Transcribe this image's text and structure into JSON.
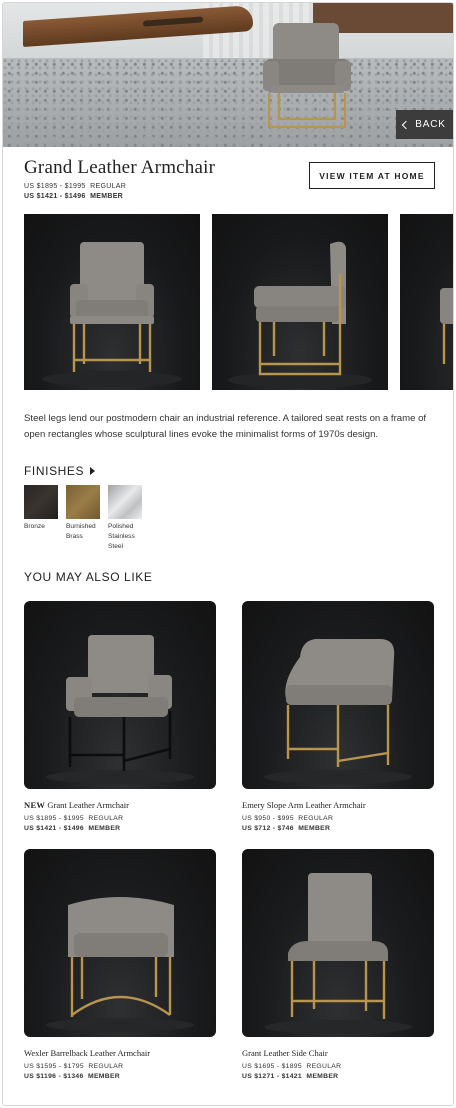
{
  "hero": {
    "back_label": "BACK"
  },
  "product": {
    "title": "Grand Leather Armchair",
    "regular_price": "US $1895 - $1995",
    "regular_label": "REGULAR",
    "member_price": "US $1421 - $1496",
    "member_label": "MEMBER",
    "view_at_home": "VIEW ITEM AT HOME",
    "description": "Steel legs lend our postmodern chair an industrial reference. A tailored seat rests on a frame of open rectangles whose sculptural lines evoke the minimalist forms of 1970s design."
  },
  "finishes": {
    "heading": "FINISHES",
    "items": [
      {
        "label": "Bronze",
        "color": "#2f2a26"
      },
      {
        "label": "Burnished Brass",
        "color": "#8a7040"
      },
      {
        "label": "Polished Stainless Steel",
        "color": "#c9cbcd"
      }
    ]
  },
  "also_like": {
    "heading": "YOU MAY ALSO LIKE",
    "items": [
      {
        "badge": "NEW",
        "name": "Grant Leather Armchair",
        "regular": "US $1895 - $1995",
        "regular_label": "REGULAR",
        "member": "US $1421 - $1496",
        "member_label": "MEMBER"
      },
      {
        "badge": "",
        "name": "Emery Slope Arm Leather Armchair",
        "regular": "US $950 - $995",
        "regular_label": "REGULAR",
        "member": "US $712 - $746",
        "member_label": "MEMBER"
      },
      {
        "badge": "",
        "name": "Wexler Barrelback Leather Armchair",
        "regular": "US $1595 - $1795",
        "regular_label": "REGULAR",
        "member": "US $1196 - $1346",
        "member_label": "MEMBER"
      },
      {
        "badge": "",
        "name": "Grant Leather Side Chair",
        "regular": "US $1695 - $1895",
        "regular_label": "REGULAR",
        "member": "US $1271 - $1421",
        "member_label": "MEMBER"
      }
    ]
  },
  "colors": {
    "leather": "#8d8a86",
    "brass": "#b8954f",
    "dark_bg": "#161718"
  }
}
